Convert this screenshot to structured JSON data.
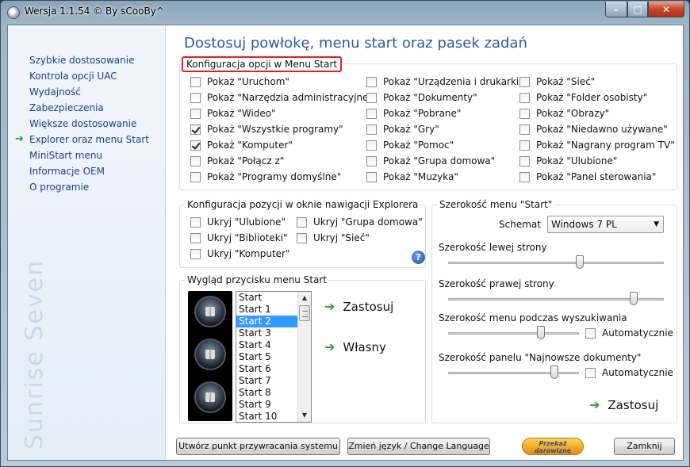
{
  "window": {
    "title": "Wersja 1.1.54 © By sCooBy^"
  },
  "sidebar": {
    "items": [
      {
        "label": "Szybkie dostosowanie",
        "active": false
      },
      {
        "label": "Kontrola opcji UAC",
        "active": false
      },
      {
        "label": "Wydajność",
        "active": false
      },
      {
        "label": "Zabezpieczenia",
        "active": false
      },
      {
        "label": "Większe dostosowanie",
        "active": false
      },
      {
        "label": "Explorer oraz menu Start",
        "active": true
      },
      {
        "label": "MiniStart menu",
        "active": false
      },
      {
        "label": "Informacje OEM",
        "active": false
      },
      {
        "label": "O programie",
        "active": false
      }
    ],
    "brand": "Sunrise Seven",
    "active_arrow": "➔"
  },
  "main": {
    "heading": "Dostosuj powłokę, menu start oraz pasek zadań",
    "start_menu_options": {
      "title": "Konfiguracja opcji w Menu Start",
      "col1": [
        {
          "label": "Pokaż \"Uruchom\"",
          "checked": false
        },
        {
          "label": "Pokaż \"Narzędzia administracyjne\"",
          "checked": false
        },
        {
          "label": "Pokaż \"Wideo\"",
          "checked": false
        },
        {
          "label": "Pokaż \"Wszystkie programy\"",
          "checked": true
        },
        {
          "label": "Pokaż \"Komputer\"",
          "checked": true
        },
        {
          "label": "Pokaż \"Połącz z\"",
          "checked": false
        },
        {
          "label": "Pokaż \"Programy domyślne\"",
          "checked": false
        }
      ],
      "col2": [
        {
          "label": "Pokaż \"Urządzenia i drukarki\"",
          "checked": false
        },
        {
          "label": "Pokaż \"Dokumenty\"",
          "checked": false
        },
        {
          "label": "Pokaż \"Pobrane\"",
          "checked": false
        },
        {
          "label": "Pokaż \"Gry\"",
          "checked": false
        },
        {
          "label": "Pokaż \"Pomoc\"",
          "checked": false
        },
        {
          "label": "Pokaż \"Grupa domowa\"",
          "checked": false
        },
        {
          "label": "Pokaż \"Muzyka\"",
          "checked": false
        }
      ],
      "col3": [
        {
          "label": "Pokaż \"Sieć\"",
          "checked": false
        },
        {
          "label": "Pokaż \"Folder osobisty\"",
          "checked": false
        },
        {
          "label": "Pokaż \"Obrazy\"",
          "checked": false
        },
        {
          "label": "Pokaż \"Niedawno używane\"",
          "checked": false
        },
        {
          "label": "Pokaż \"Nagrany program TV\"",
          "checked": false
        },
        {
          "label": "Pokaż \"Ulubione\"",
          "checked": false
        },
        {
          "label": "Pokaż \"Panel sterowania\"",
          "checked": false
        }
      ]
    },
    "explorer_nav": {
      "title": "Konfiguracja pozycji w oknie nawigacji Explorera",
      "items": [
        {
          "label": "Ukryj \"Ulubione\"",
          "checked": false
        },
        {
          "label": "Ukryj \"Biblioteki\"",
          "checked": false
        },
        {
          "label": "Ukryj \"Komputer\"",
          "checked": false
        },
        {
          "label": "Ukryj \"Grupa domowa\"",
          "checked": false
        },
        {
          "label": "Ukryj  \"Sieć\"",
          "checked": false
        }
      ],
      "help": "?"
    },
    "start_button": {
      "title": "Wygląd przycisku menu Start",
      "list": [
        "Start",
        "Start 1",
        "Start 2",
        "Start 3",
        "Start 4",
        "Start 5",
        "Start 6",
        "Start 7",
        "Start 8",
        "Start 9",
        "Start 10"
      ],
      "selected": "Start 2",
      "apply_label": "Zastosuj",
      "custom_label": "Własny"
    },
    "start_width": {
      "title": "Szerokość menu \"Start\"",
      "scheme_label": "Schemat",
      "scheme_value": "Windows 7 PL",
      "left_label": "Szerokość lewej strony",
      "left_level": 0.61,
      "right_label": "Szerokość prawej strony",
      "right_level": 0.86,
      "search_label": "Szerokość menu podczas wyszukiwania",
      "search_level": 0.71,
      "search_auto_label": "Automatycznie",
      "search_auto": false,
      "recent_label": "Szerokość panelu \"Najnowsze dokumenty\"",
      "recent_level": 0.81,
      "recent_auto_label": "Automatycznie",
      "recent_auto": false,
      "apply_label": "Zastosuj"
    }
  },
  "footer": {
    "restore_point": "Utwórz punkt przywracania systemu",
    "language": "Zmień język / Change Language",
    "donate": "Przekaż darowiznę",
    "close": "Zamknij"
  },
  "colors": {
    "accent": "#2c5aa0",
    "nav_link": "#1a3f8f",
    "arrow": "#2c9e3a",
    "highlight": "#e02020",
    "selection": "#3399ff"
  }
}
